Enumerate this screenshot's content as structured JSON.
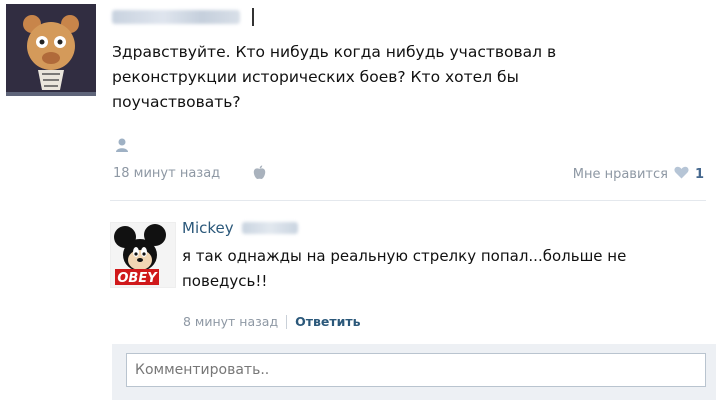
{
  "post": {
    "author_name": "",
    "text": "Здравствуйте. Кто нибудь когда нибудь участвовал в реконструкции исторических боев? Кто хотел бы поучаствовать?",
    "time": "18 минут назад",
    "like_label": "Мне нравится",
    "like_count": "1"
  },
  "comment": {
    "author_name": "Mickey",
    "avatar_label": "OBEY",
    "text": "я так однажды на реальную стрелку попал...больше не поведусь!!",
    "time": "8 минут назад",
    "reply_label": "Ответить"
  },
  "reply_form": {
    "placeholder": "Комментировать.."
  },
  "icons": {
    "attach": "person-icon",
    "device": "apple-icon",
    "like": "heart-icon"
  },
  "colors": {
    "link": "#2b587a",
    "meta": "#8e98a4",
    "reply_box_bg": "#edf0f4"
  }
}
